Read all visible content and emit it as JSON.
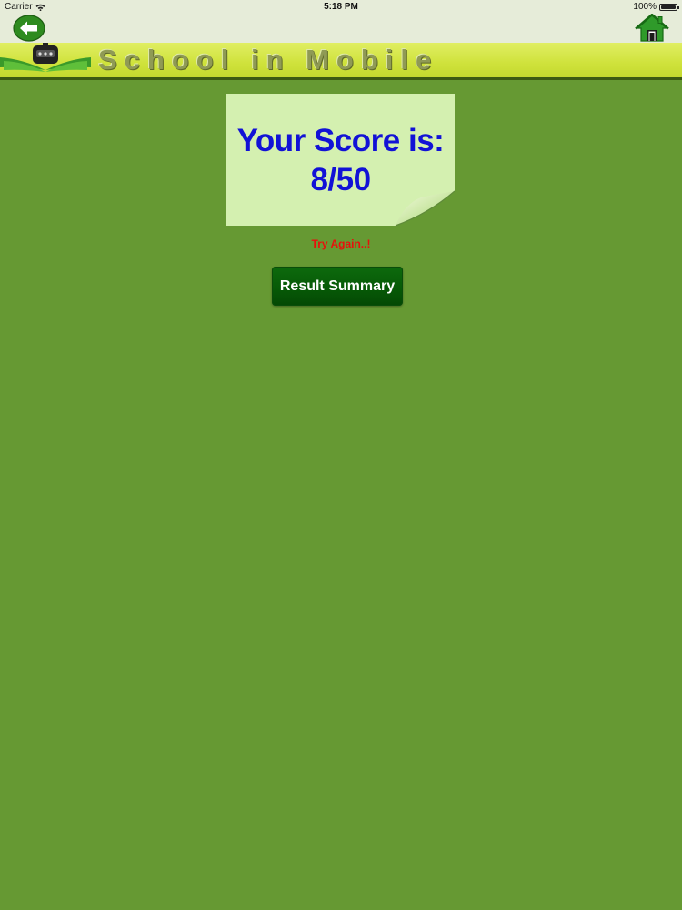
{
  "status_bar": {
    "carrier": "Carrier",
    "time": "5:18 PM",
    "battery": "100%",
    "battery_level": 1.0
  },
  "navbar": {
    "back_icon": "back-arrow-icon",
    "home_icon": "home-icon"
  },
  "banner": {
    "title": "School in Mobile",
    "logo_icon": "school-logo-icon"
  },
  "score": {
    "heading": "Your Score is:",
    "value": "8/50"
  },
  "result_message": "Try Again..!",
  "summary_button_label": "Result Summary",
  "colors": {
    "background": "#669933",
    "score_text": "#1212d6",
    "message": "#e8100c",
    "button": "#075a07",
    "banner": "#d4e64a"
  }
}
